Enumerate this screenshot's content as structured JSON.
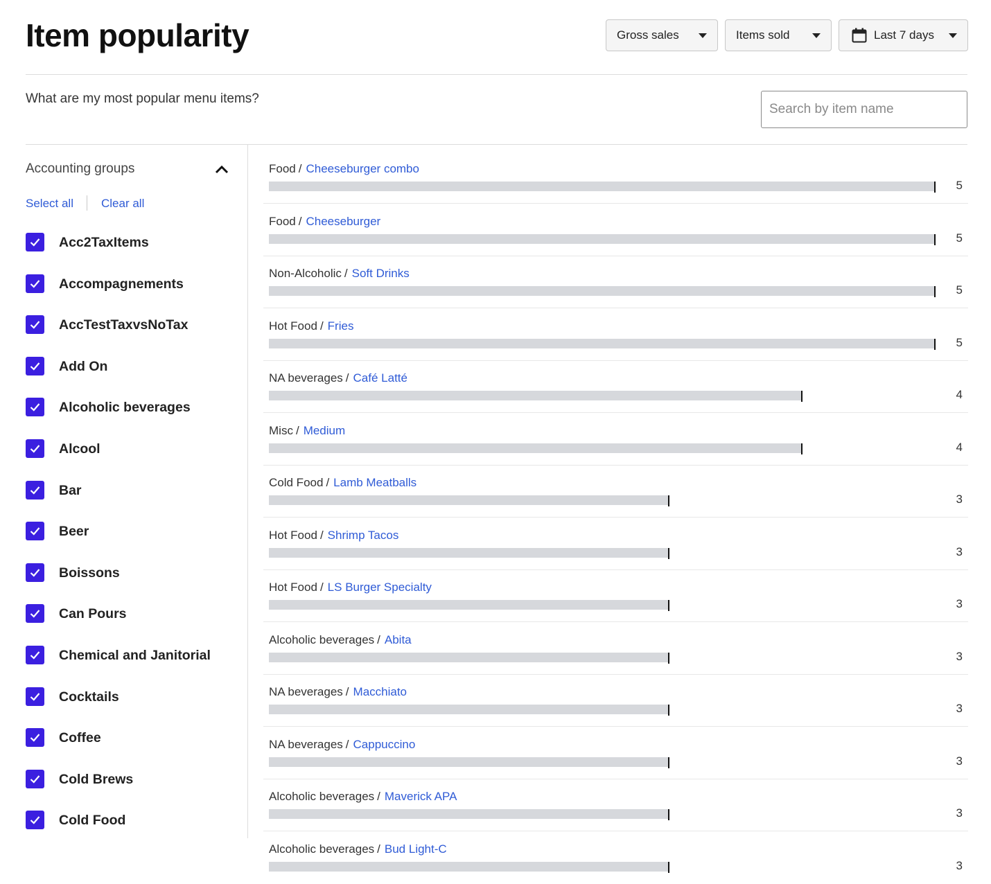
{
  "header": {
    "title": "Item popularity",
    "metric_dropdown": "Gross sales",
    "measure_dropdown": "Items sold",
    "date_dropdown": "Last 7 days"
  },
  "subheader": {
    "question": "What are my most popular menu items?",
    "search_placeholder": "Search by item name"
  },
  "sidebar": {
    "title": "Accounting groups",
    "select_all": "Select all",
    "clear_all": "Clear all",
    "groups": [
      {
        "label": "Acc2TaxItems",
        "checked": true
      },
      {
        "label": "Accompagnements",
        "checked": true
      },
      {
        "label": "AccTestTaxvsNoTax",
        "checked": true
      },
      {
        "label": "Add On",
        "checked": true
      },
      {
        "label": "Alcoholic beverages",
        "checked": true
      },
      {
        "label": "Alcool",
        "checked": true
      },
      {
        "label": "Bar",
        "checked": true
      },
      {
        "label": "Beer",
        "checked": true
      },
      {
        "label": "Boissons",
        "checked": true
      },
      {
        "label": "Can Pours",
        "checked": true
      },
      {
        "label": "Chemical and Janitorial",
        "checked": true
      },
      {
        "label": "Cocktails",
        "checked": true
      },
      {
        "label": "Coffee",
        "checked": true
      },
      {
        "label": "Cold Brews",
        "checked": true
      },
      {
        "label": "Cold Food",
        "checked": true
      }
    ]
  },
  "max_value": 5,
  "items": [
    {
      "category": "Food",
      "name": "Cheeseburger combo",
      "value": 5
    },
    {
      "category": "Food",
      "name": "Cheeseburger",
      "value": 5
    },
    {
      "category": "Non-Alcoholic",
      "name": "Soft Drinks",
      "value": 5
    },
    {
      "category": "Hot Food",
      "name": "Fries",
      "value": 5
    },
    {
      "category": "NA beverages",
      "name": "Café Latté",
      "value": 4
    },
    {
      "category": "Misc",
      "name": "Medium",
      "value": 4
    },
    {
      "category": "Cold Food",
      "name": "Lamb Meatballs",
      "value": 3
    },
    {
      "category": "Hot Food",
      "name": "Shrimp Tacos",
      "value": 3
    },
    {
      "category": "Hot Food",
      "name": "LS Burger Specialty",
      "value": 3
    },
    {
      "category": "Alcoholic beverages",
      "name": "Abita",
      "value": 3
    },
    {
      "category": "NA beverages",
      "name": "Macchiato",
      "value": 3
    },
    {
      "category": "NA beverages",
      "name": "Cappuccino",
      "value": 3
    },
    {
      "category": "Alcoholic beverages",
      "name": "Maverick APA",
      "value": 3
    },
    {
      "category": "Alcoholic beverages",
      "name": "Bud Light-C",
      "value": 3
    }
  ]
}
